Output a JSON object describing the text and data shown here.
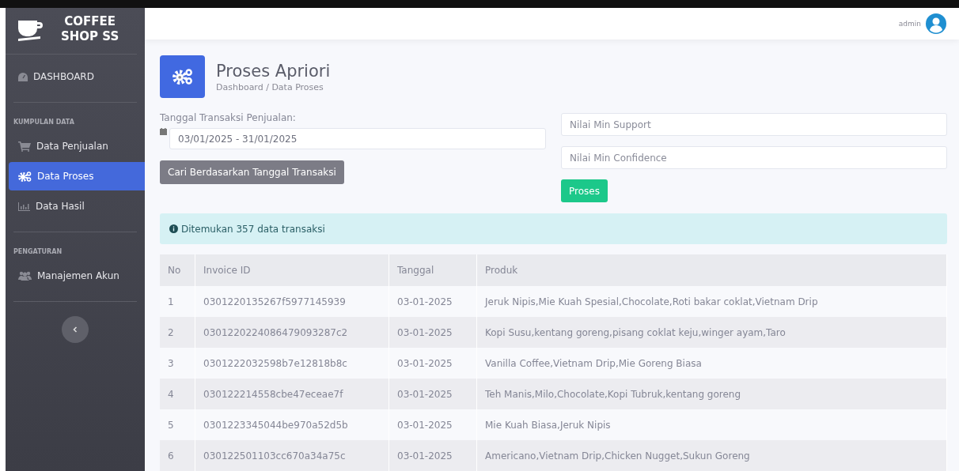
{
  "sidebar": {
    "brand_lines": [
      "COFFEE",
      "SHOP SS"
    ],
    "sections": [
      {
        "items": [
          {
            "label": "DASHBOARD",
            "selected": false
          }
        ]
      },
      {
        "heading": "KUMPULAN DATA",
        "items": [
          {
            "label": "Data Penjualan",
            "selected": false
          },
          {
            "label": "Data Proses",
            "selected": true
          },
          {
            "label": "Data Hasil",
            "selected": false
          }
        ]
      },
      {
        "heading": "PENGATURAN",
        "items": [
          {
            "label": "Manajemen Akun",
            "selected": false
          }
        ]
      }
    ]
  },
  "topbar": {
    "user": "admin"
  },
  "page": {
    "title": "Proses Apriori",
    "breadcrumb": "Dashboard / Data Proses"
  },
  "date_form": {
    "label": "Tanggal Transaksi Penjualan:",
    "value": "03/01/2025 - 31/01/2025",
    "button": "Cari Berdasarkan Tanggal Transaksi"
  },
  "apriori_form": {
    "fields": [
      {
        "placeholder": "Nilai Min Support"
      },
      {
        "placeholder": "Nilai Min Confidence"
      }
    ],
    "button": "Proses"
  },
  "alert": "Ditemukan 357 data transaksi",
  "table": {
    "columns": [
      "No",
      "Invoice ID",
      "Tanggal",
      "Produk"
    ],
    "rows": [
      [
        "1",
        "0301220135267f5977145939",
        "03-01-2025",
        "Jeruk Nipis,Mie Kuah Spesial,Chocolate,Roti bakar coklat,Vietnam Drip"
      ],
      [
        "2",
        "0301220224086479093287c2",
        "03-01-2025",
        "Kopi Susu,kentang goreng,pisang coklat keju,winger ayam,Taro"
      ],
      [
        "3",
        "0301222032598b7e12818b8c",
        "03-01-2025",
        "Vanilla Coffee,Vietnam Drip,Mie Goreng Biasa"
      ],
      [
        "4",
        "030122214558cbe47eceae7f",
        "03-01-2025",
        "Teh Manis,Milo,Chocolate,Kopi Tubruk,kentang goreng"
      ],
      [
        "5",
        "0301223345044be970a52d5b",
        "03-01-2025",
        "Mie Kuah Biasa,Jeruk Nipis"
      ],
      [
        "6",
        "030122501103cc670a34a75c",
        "03-01-2025",
        "Americano,Vietnam Drip,Chicken Nugget,Sukun Goreng"
      ]
    ]
  }
}
